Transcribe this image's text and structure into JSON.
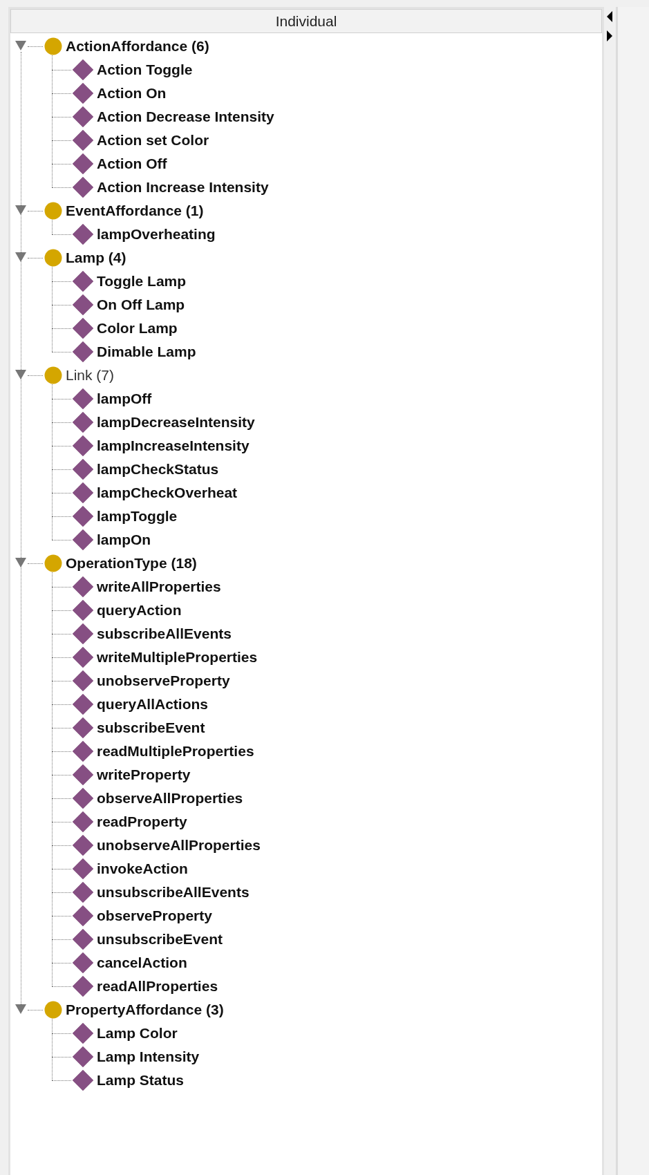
{
  "tree": {
    "header": "Individual",
    "groups": [
      {
        "label": "ActionAffordance (6)",
        "bold": true,
        "expanded": true,
        "children": [
          {
            "label": "Action Toggle"
          },
          {
            "label": "Action On"
          },
          {
            "label": "Action Decrease Intensity"
          },
          {
            "label": "Action set Color"
          },
          {
            "label": "Action Off"
          },
          {
            "label": "Action Increase Intensity"
          }
        ]
      },
      {
        "label": "EventAffordance (1)",
        "bold": true,
        "expanded": true,
        "children": [
          {
            "label": "lampOverheating"
          }
        ]
      },
      {
        "label": "Lamp (4)",
        "bold": true,
        "expanded": true,
        "children": [
          {
            "label": "Toggle Lamp"
          },
          {
            "label": "On Off Lamp"
          },
          {
            "label": "Color Lamp"
          },
          {
            "label": "Dimable Lamp"
          }
        ]
      },
      {
        "label": "Link (7)",
        "bold": false,
        "expanded": true,
        "children": [
          {
            "label": "lampOff"
          },
          {
            "label": "lampDecreaseIntensity"
          },
          {
            "label": "lampIncreaseIntensity"
          },
          {
            "label": "lampCheckStatus"
          },
          {
            "label": "lampCheckOverheat"
          },
          {
            "label": "lampToggle"
          },
          {
            "label": "lampOn"
          }
        ]
      },
      {
        "label": "OperationType (18)",
        "bold": true,
        "expanded": true,
        "children": [
          {
            "label": "writeAllProperties"
          },
          {
            "label": "queryAction"
          },
          {
            "label": "subscribeAllEvents"
          },
          {
            "label": "writeMultipleProperties"
          },
          {
            "label": "unobserveProperty"
          },
          {
            "label": "queryAllActions"
          },
          {
            "label": "subscribeEvent"
          },
          {
            "label": "readMultipleProperties"
          },
          {
            "label": "writeProperty"
          },
          {
            "label": "observeAllProperties"
          },
          {
            "label": "readProperty"
          },
          {
            "label": "unobserveAllProperties"
          },
          {
            "label": "invokeAction"
          },
          {
            "label": "unsubscribeAllEvents"
          },
          {
            "label": "observeProperty"
          },
          {
            "label": "unsubscribeEvent"
          },
          {
            "label": "cancelAction"
          },
          {
            "label": "readAllProperties"
          }
        ]
      },
      {
        "label": "PropertyAffordance (3)",
        "bold": true,
        "expanded": true,
        "children": [
          {
            "label": "Lamp Color"
          },
          {
            "label": "Lamp Intensity"
          },
          {
            "label": "Lamp Status"
          }
        ]
      }
    ]
  }
}
